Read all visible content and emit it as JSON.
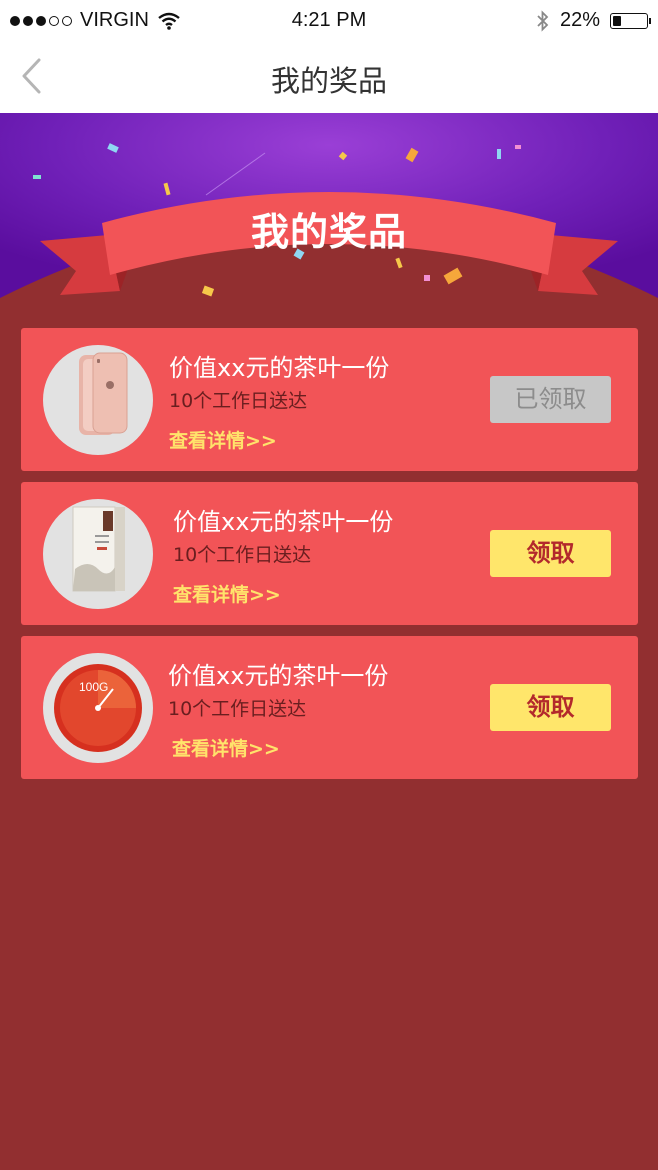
{
  "status_bar": {
    "carrier": "VIRGIN",
    "time": "4:21 PM",
    "battery": "22%"
  },
  "nav": {
    "title": "我的奖品"
  },
  "banner": {
    "title": "我的奖品"
  },
  "prizes": [
    {
      "name": "价值xx元的茶叶一份",
      "eta": "10个工作日送达",
      "detail": "查看详情>>",
      "button": "已领取",
      "state": "claimed",
      "image": "rose-gold-phone"
    },
    {
      "name": "价值xx元的茶叶一份",
      "eta": "10个工作日送达",
      "detail": "查看详情>>",
      "button": "领取",
      "state": "available",
      "image": "tea-box"
    },
    {
      "name": "价值xx元的茶叶一份",
      "eta": "10个工作日送达",
      "detail": "查看详情>>",
      "button": "领取",
      "state": "available",
      "image": "data-gauge",
      "image_label": "100G"
    }
  ],
  "colors": {
    "background": "#922f30",
    "card": "#f25457",
    "banner_purple": "#6a17b0",
    "claim_button": "#ffe66b",
    "claimed_button": "#c7c7c7",
    "detail_link": "#ffe36b"
  }
}
